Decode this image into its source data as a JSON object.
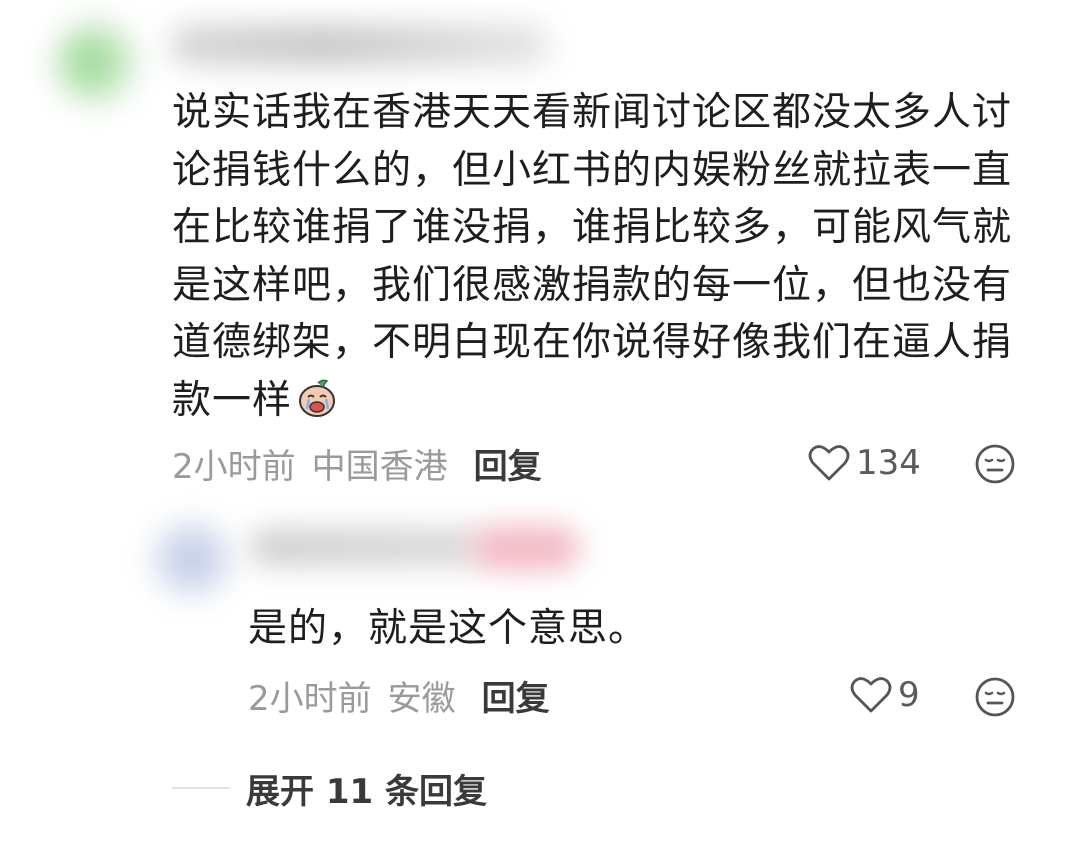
{
  "comment": {
    "text": "说实话我在香港天天看新闻讨论区都没太多人讨论捐钱什么的，但小红书的内娱粉丝就拉表一直在比较谁捐了谁没捐，谁捐比较多，可能风气就是这样吧，我们很感激捐款的每一位，但也没有道德绑架，不明白现在你说得好像我们在逼人捐款一样",
    "emoji_icon": "crying-face-emoji-icon",
    "time": "2小时前",
    "location": "中国香港",
    "reply_label": "回复",
    "likes": "134"
  },
  "reply": {
    "text": "是的，就是这个意思。",
    "time": "2小时前",
    "location": "安徽",
    "reply_label": "回复",
    "likes": "9"
  },
  "expand": {
    "label": "展开 11 条回复"
  },
  "icons": {
    "like": "heart-outline-icon",
    "dislike": "neutral-face-icon"
  },
  "colors": {
    "text_primary": "#1e1e1e",
    "text_meta": "#9a9a9a",
    "text_action": "#3a3a3a"
  }
}
